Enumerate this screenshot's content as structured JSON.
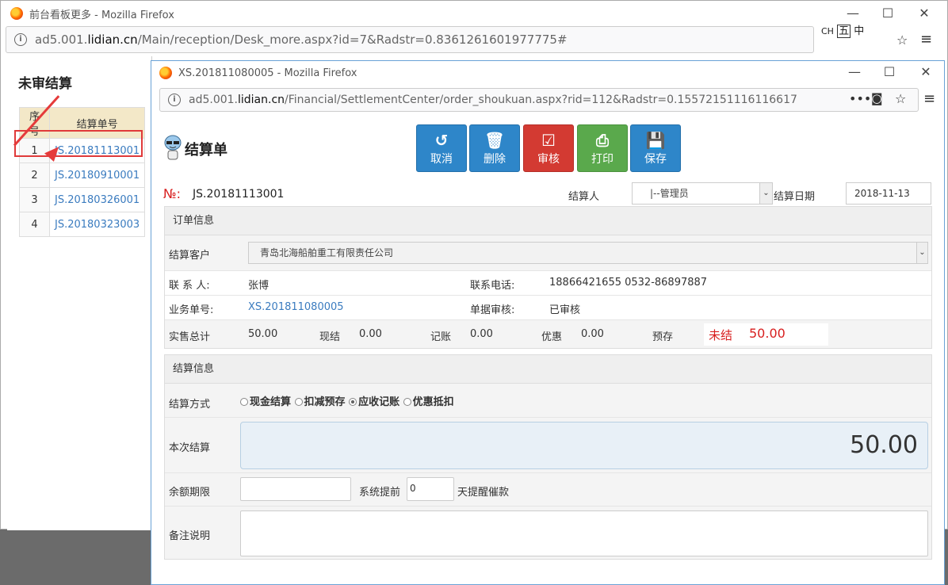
{
  "back_window": {
    "title": "前台看板更多 - Mozilla Firefox",
    "url_prefix": "ad5.001.",
    "url_domain": "lidian.cn",
    "url_rest": "/Main/reception/Desk_more.aspx?id=7&Radstr=0.8361261601977775#",
    "heading": "未审结算",
    "table": {
      "headers": [
        "序号",
        "结算单号"
      ],
      "rows": [
        {
          "num": "1",
          "code": "JS.20181113001"
        },
        {
          "num": "2",
          "code": "JS.20180910001"
        },
        {
          "num": "3",
          "code": "JS.20180326001"
        },
        {
          "num": "4",
          "code": "JS.20180323003"
        }
      ]
    }
  },
  "ime": {
    "ch": "CH",
    "wu": "五",
    "zhong": "中"
  },
  "front_window": {
    "title": "XS.201811080005 - Mozilla Firefox",
    "url_prefix": "ad5.001.",
    "url_domain": "lidian.cn",
    "url_rest": "/Financial/SettlementCenter/order_shoukuan.aspx?rid=112&Radstr=0.15572151116116617",
    "page_title": "结算单",
    "toolbar": {
      "cancel": "取消",
      "delete": "删除",
      "audit": "审核",
      "print": "打印",
      "save": "保存"
    },
    "no_label": "№:",
    "order_no": "JS.20181113001",
    "settler_label": "结算人",
    "settler_value": "|--管理员",
    "date_label": "结算日期",
    "date_value": "2018-11-13",
    "order_info": {
      "title": "订单信息",
      "customer_label": "结算客户",
      "customer_value": "青岛北海船舶重工有限责任公司",
      "contact_label": "联 系 人:",
      "contact_value": "张博",
      "phone_label": "联系电话:",
      "phone_value": "18866421655 0532-86897887",
      "bizno_label": "业务单号:",
      "bizno_value": "XS.201811080005",
      "review_label": "单据审核:",
      "review_value": "已审核",
      "total_label": "实售总计",
      "total_value": "50.00",
      "cash_label": "现结",
      "cash_value": "0.00",
      "account_label": "记账",
      "account_value": "0.00",
      "discount_label": "优惠",
      "discount_value": "0.00",
      "prepay_label": "预存",
      "status_label": "未结",
      "status_value": "50.00"
    },
    "settle_info": {
      "title": "结算信息",
      "method_label": "结算方式",
      "methods": [
        "现金结算",
        "扣减预存",
        "应收记账",
        "优惠抵扣"
      ],
      "current_label": "本次结算",
      "current_value": "50.00",
      "deadline_label": "余额期限",
      "remind_label": "系统提前",
      "remind_days": "0",
      "remind_suffix": "天提醒催款",
      "memo_label": "备注说明"
    }
  }
}
